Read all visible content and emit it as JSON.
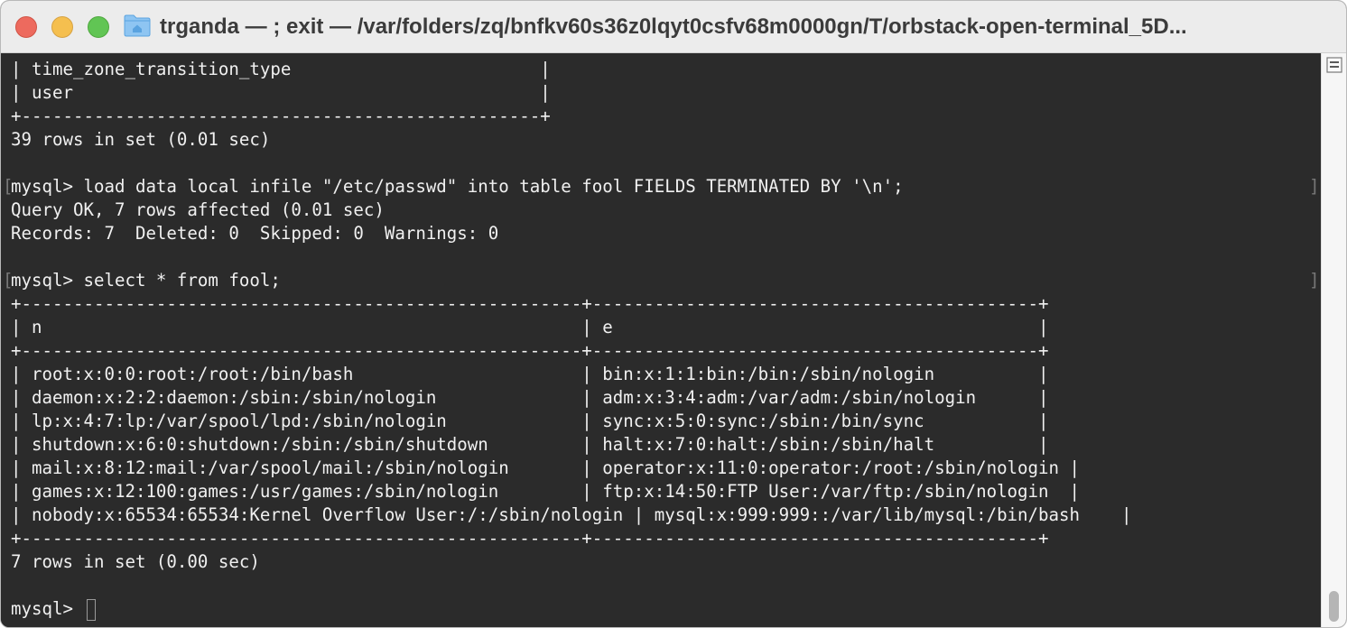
{
  "window": {
    "title": "trganda — ; exit — /var/folders/zq/bnfkv60s36z0lqyt0csfv68m0000gn/T/orbstack-open-terminal_5D..."
  },
  "terminal": {
    "lines": [
      "| time_zone_transition_type                        |",
      "| user                                             |",
      "+--------------------------------------------------+",
      "39 rows in set (0.01 sec)",
      "",
      "mysql> load data local infile \"/etc/passwd\" into table fool FIELDS TERMINATED BY '\\n';",
      "Query OK, 7 rows affected (0.01 sec)",
      "Records: 7  Deleted: 0  Skipped: 0  Warnings: 0",
      "",
      "mysql> select * from fool;",
      "+------------------------------------------------------+-------------------------------------------+",
      "| n                                                    | e                                         |",
      "+------------------------------------------------------+-------------------------------------------+",
      "| root:x:0:0:root:/root:/bin/bash                      | bin:x:1:1:bin:/bin:/sbin/nologin          |",
      "| daemon:x:2:2:daemon:/sbin:/sbin/nologin              | adm:x:3:4:adm:/var/adm:/sbin/nologin      |",
      "| lp:x:4:7:lp:/var/spool/lpd:/sbin/nologin             | sync:x:5:0:sync:/sbin:/bin/sync           |",
      "| shutdown:x:6:0:shutdown:/sbin:/sbin/shutdown         | halt:x:7:0:halt:/sbin:/sbin/halt          |",
      "| mail:x:8:12:mail:/var/spool/mail:/sbin/nologin       | operator:x:11:0:operator:/root:/sbin/nologin |",
      "| games:x:12:100:games:/usr/games:/sbin/nologin        | ftp:x:14:50:FTP User:/var/ftp:/sbin/nologin  |",
      "| nobody:x:65534:65534:Kernel Overflow User:/:/sbin/nologin | mysql:x:999:999::/var/lib/mysql:/bin/bash    |",
      "+------------------------------------------------------+-------------------------------------------+",
      "7 rows in set (0.00 sec)",
      "",
      "mysql> "
    ],
    "mark_left": "[",
    "mark_right": "]"
  },
  "icons": {
    "title_icon": "folder-home-icon",
    "scroll_icon": "scrollbar-menu-icon"
  },
  "colors": {
    "terminal_bg": "#2b2b2b",
    "terminal_fg": "#f0f0f0",
    "titlebar_bg": "#ececec",
    "close": "#ed6a5e",
    "minimize": "#f5bf4f",
    "zoom": "#61c554"
  }
}
